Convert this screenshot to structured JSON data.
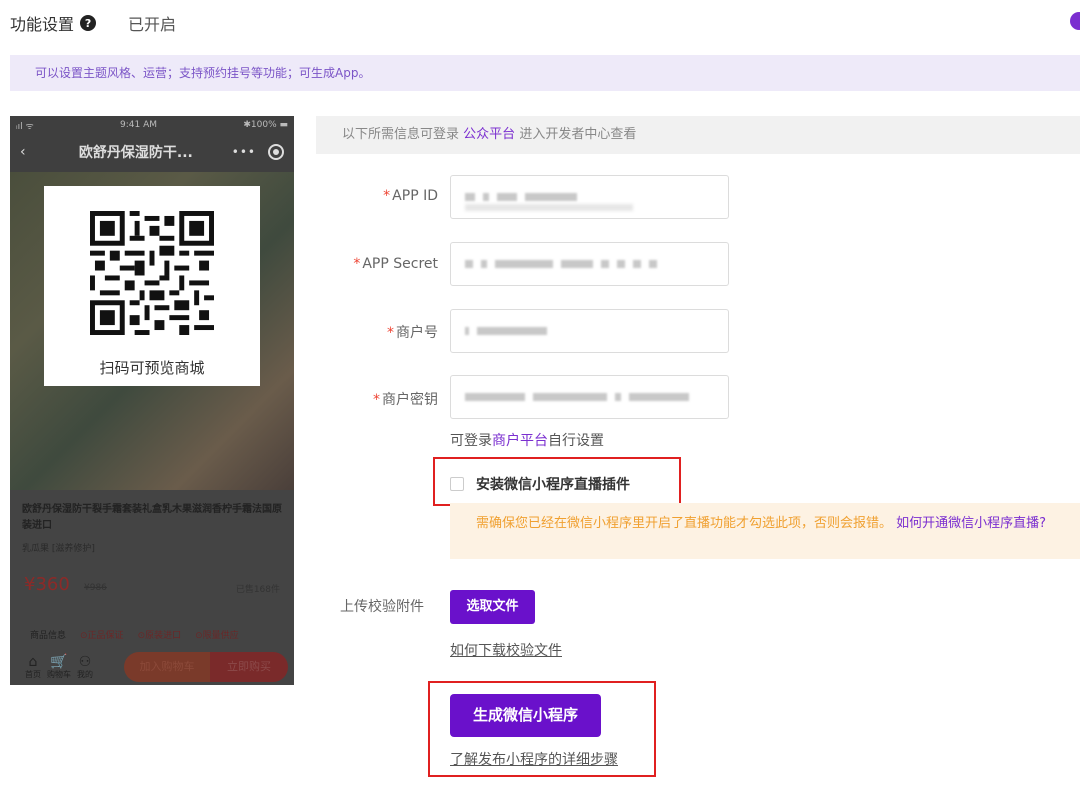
{
  "header": {
    "title": "功能设置",
    "help_icon": "?",
    "status": "已开启"
  },
  "notice": "可以设置主题风格、运营；支持预约挂号等功能；可生成App。",
  "phone": {
    "statusbar": {
      "signal": "ᵢıl ᯤ",
      "time": "9:41 AM",
      "battery": "✱100% ▬"
    },
    "nav_title": "欧舒丹保湿防干...",
    "back_icon": "‹",
    "more_icon": "•••",
    "product_name": "欧舒丹保湿防干裂手霜套装礼盒乳木果滋润香柠手霜法国原装进口",
    "brand": "乳瓜果 [滋养修护]",
    "price": "¥360",
    "old_price": "¥986",
    "sold": "已售168件",
    "guarantees": [
      "商品信息",
      "⊙正品保证",
      "⊙原装进口",
      "⊙限量供应"
    ],
    "bottom_icons": [
      {
        "icon": "⌂",
        "label": "首页"
      },
      {
        "icon": "🛒",
        "label": "购物车"
      },
      {
        "icon": "⚇",
        "label": "我的"
      }
    ],
    "cart_button": "加入购物车",
    "buy_button": "立即购买"
  },
  "qr": {
    "label": "扫码可预览商城"
  },
  "info": {
    "prefix": "以下所需信息可登录",
    "link": "公众平台",
    "suffix": "进入开发者中心查看"
  },
  "form": {
    "app_id": {
      "label": "APP ID",
      "required": "*"
    },
    "app_secret": {
      "label": "APP Secret",
      "required": "*"
    },
    "merchant_no": {
      "label": "商户号",
      "required": "*"
    },
    "merchant_key": {
      "label": "商户密钥",
      "required": "*"
    }
  },
  "merchant_note": {
    "prefix": "可登录",
    "link": "商户平台",
    "suffix": "自行设置"
  },
  "checkbox": {
    "label": "安装微信小程序直播插件",
    "checked": false
  },
  "warning": {
    "text": "需确保您已经在微信小程序里开启了直播功能才勾选此项，否则会报错。",
    "link": "如何开通微信小程序直播?"
  },
  "upload": {
    "label": "上传校验附件",
    "button": "选取文件",
    "help_link": "如何下载校验文件"
  },
  "generate": {
    "button": "生成微信小程序",
    "link": "了解发布小程序的详细步骤"
  },
  "colors": {
    "accent": "#6a11cb",
    "link": "#7b2fd0",
    "required": "#e43",
    "highlight_box": "#e02020"
  }
}
